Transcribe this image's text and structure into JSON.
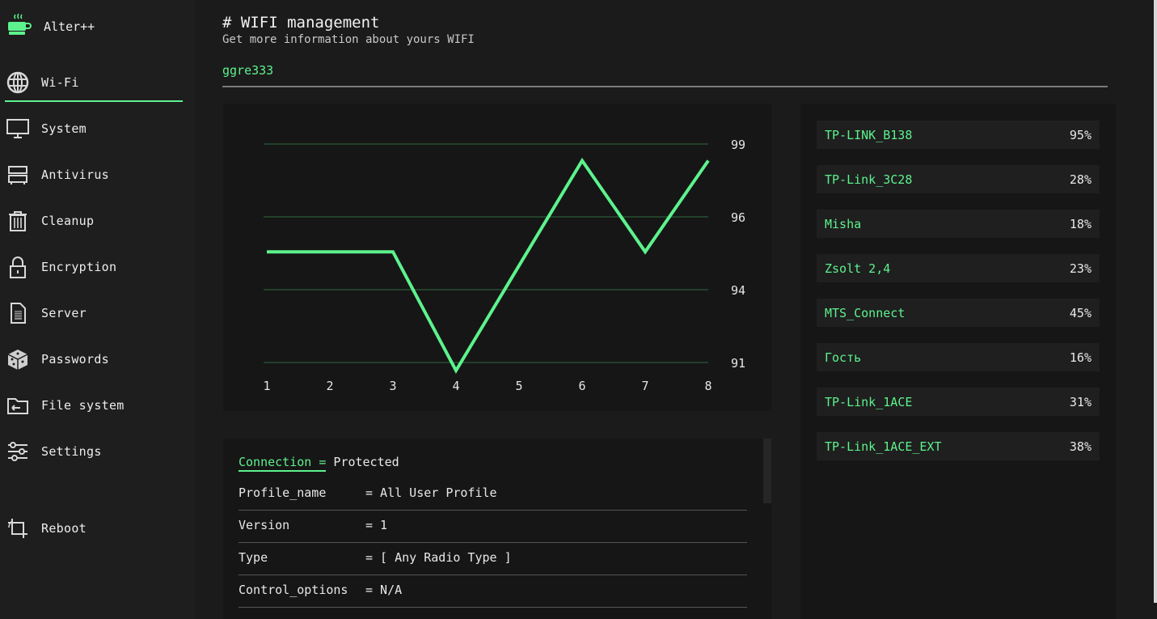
{
  "app": {
    "name": "Alter++",
    "logo_icon": "coffee-cup-icon"
  },
  "sidebar": {
    "items": [
      {
        "label": "Wi-Fi",
        "icon": "globe-icon",
        "active": true
      },
      {
        "label": "System",
        "icon": "monitor-icon"
      },
      {
        "label": "Antivirus",
        "icon": "server-rack-icon"
      },
      {
        "label": "Cleanup",
        "icon": "trash-icon"
      },
      {
        "label": "Encryption",
        "icon": "lock-icon"
      },
      {
        "label": "Server",
        "icon": "document-icon"
      },
      {
        "label": "Passwords",
        "icon": "dice-icon"
      },
      {
        "label": "File system",
        "icon": "folder-icon"
      },
      {
        "label": "Settings",
        "icon": "sliders-icon"
      }
    ],
    "reboot": {
      "label": "Reboot",
      "icon": "crop-rotate-icon"
    }
  },
  "header": {
    "hash": "#",
    "title": "WIFI management",
    "subtitle": "Get more information about yours WIFI",
    "ssid": "ggre333"
  },
  "colors": {
    "accent": "#5df28d",
    "grid": "#2f6b3f",
    "panel": "#161616"
  },
  "chart_data": {
    "type": "line",
    "x": [
      1,
      2,
      3,
      4,
      5,
      6,
      7,
      8
    ],
    "series": [
      {
        "values": [
          95,
          95,
          95,
          90.7,
          94.5,
          98.3,
          95,
          98.3
        ]
      }
    ],
    "y_ticks": [
      91,
      94,
      96,
      99
    ],
    "ylim": [
      90.7,
      98.9
    ],
    "title": "",
    "xlabel": "",
    "ylabel": "",
    "grid": true,
    "y_axis_position": "right"
  },
  "networks": [
    {
      "name": "TP-LINK_B138",
      "strength": "95%"
    },
    {
      "name": "TP-Link_3C28",
      "strength": "28%"
    },
    {
      "name": "Misha",
      "strength": "18%"
    },
    {
      "name": "Zsolt 2,4",
      "strength": "23%"
    },
    {
      "name": "MTS_Connect",
      "strength": "45%"
    },
    {
      "name": "Гость",
      "strength": "16%"
    },
    {
      "name": "TP-Link_1ACE",
      "strength": "31%"
    },
    {
      "name": "TP-Link_1ACE_EXT",
      "strength": "38%"
    }
  ],
  "connection": {
    "key": "Connection =",
    "value": "Protected",
    "rows": [
      {
        "key": "Profile_name",
        "value": "= All User Profile"
      },
      {
        "key": "Version",
        "value": "= 1"
      },
      {
        "key": "Type",
        "value": "= [ Any Radio Type ]"
      },
      {
        "key": "Control_options",
        "value": "= N/A"
      }
    ]
  }
}
